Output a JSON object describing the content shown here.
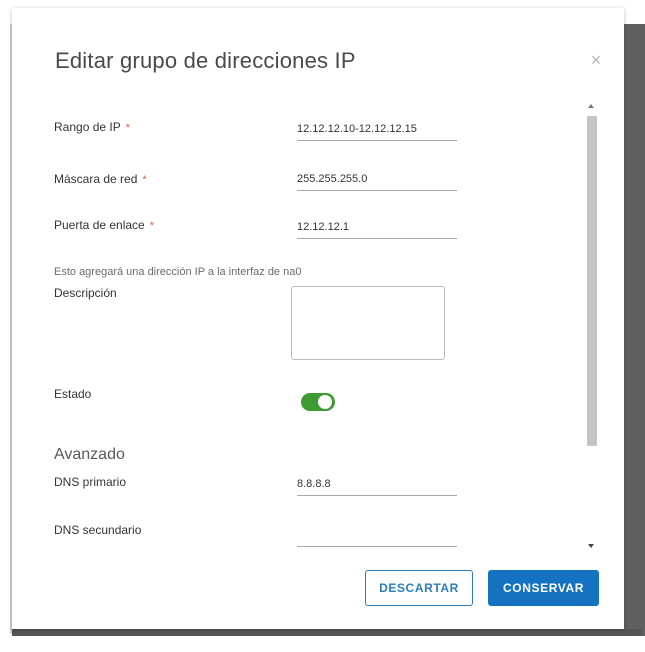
{
  "dialog": {
    "title": "Editar grupo de direcciones IP",
    "close_label": "×"
  },
  "form": {
    "ip_range": {
      "label": "Rango de IP",
      "required": "*",
      "value": "12.12.12.10-12.12.12.15"
    },
    "netmask": {
      "label": "Máscara de red",
      "required": "*",
      "value": "255.255.255.0"
    },
    "gateway": {
      "label": "Puerta de enlace",
      "required": "*",
      "value": "12.12.12.1"
    },
    "helper_text": "Esto agregará una dirección IP a la interfaz de na0",
    "description": {
      "label": "Descripción",
      "value": ""
    },
    "status": {
      "label": "Estado",
      "enabled": true,
      "color": "#3e9b32"
    },
    "advanced": {
      "title": "Avanzado",
      "dns_primary": {
        "label": "DNS primario",
        "value": "8.8.8.8"
      },
      "dns_secondary": {
        "label": "DNS secundario",
        "value": ""
      }
    }
  },
  "footer": {
    "discard_label": "DESCARTAR",
    "save_label": "CONSERVAR",
    "primary_color": "#1472c0"
  }
}
